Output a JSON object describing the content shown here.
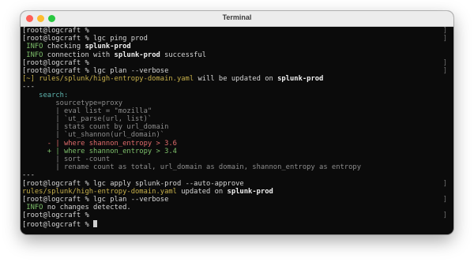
{
  "window": {
    "title": "Terminal",
    "colors": {
      "close": "#fe5f57",
      "minimize": "#febc2e",
      "maximize": "#28c840"
    }
  },
  "prompt": "root@logcraft % ",
  "terminal": {
    "l0": {
      "cmd": ""
    },
    "l1": {
      "cmd": "lgc ping prod"
    },
    "l2": {
      "level": "INFO",
      "text": " checking ",
      "bold": "splunk-prod"
    },
    "l3": {
      "level": "INFO",
      "text": " connection with ",
      "bold": "splunk-prod",
      "tail": " successful"
    },
    "l4": {
      "cmd": ""
    },
    "l5": {
      "cmd": "lgc plan --verbose"
    },
    "l6": {
      "mark": "[~]",
      "file": "rules/splunk/high-entropy-domain.yaml",
      "text": " will be updated on ",
      "bold": "splunk-prod"
    },
    "l7": {
      "text": "---"
    },
    "l8": {
      "text": "    search:"
    },
    "l9": {
      "text": "        sourcetype=proxy"
    },
    "l10": {
      "text": "        | eval list = \"mozilla\""
    },
    "l11": {
      "text": "        | `ut_parse(url, list)`"
    },
    "l12": {
      "text": "        | stats count by url_domain"
    },
    "l13": {
      "text": "        | `ut_shannon(url_domain)`"
    },
    "l14": {
      "text": "      - | where shannon_entropy > 3.6"
    },
    "l15": {
      "text": "      + | where shannon_entropy > 3.4"
    },
    "l16": {
      "text": "        | sort -count"
    },
    "l17": {
      "text": "        | rename count as total, url_domain as domain, shannon_entropy as entropy"
    },
    "l18": {
      "text": "---"
    },
    "l19": {
      "cmd": "lgc apply splunk-prod --auto-approve"
    },
    "l20": {
      "file": "rules/splunk/high-entropy-domain.yaml",
      "text": " updated on ",
      "bold": "splunk-prod"
    },
    "l21": {
      "cmd": "lgc plan --verbose"
    },
    "l22": {
      "level": "INFO",
      "text": " no changes detected."
    },
    "l23": {
      "cmd": ""
    },
    "l24": {
      "cmd": ""
    }
  }
}
